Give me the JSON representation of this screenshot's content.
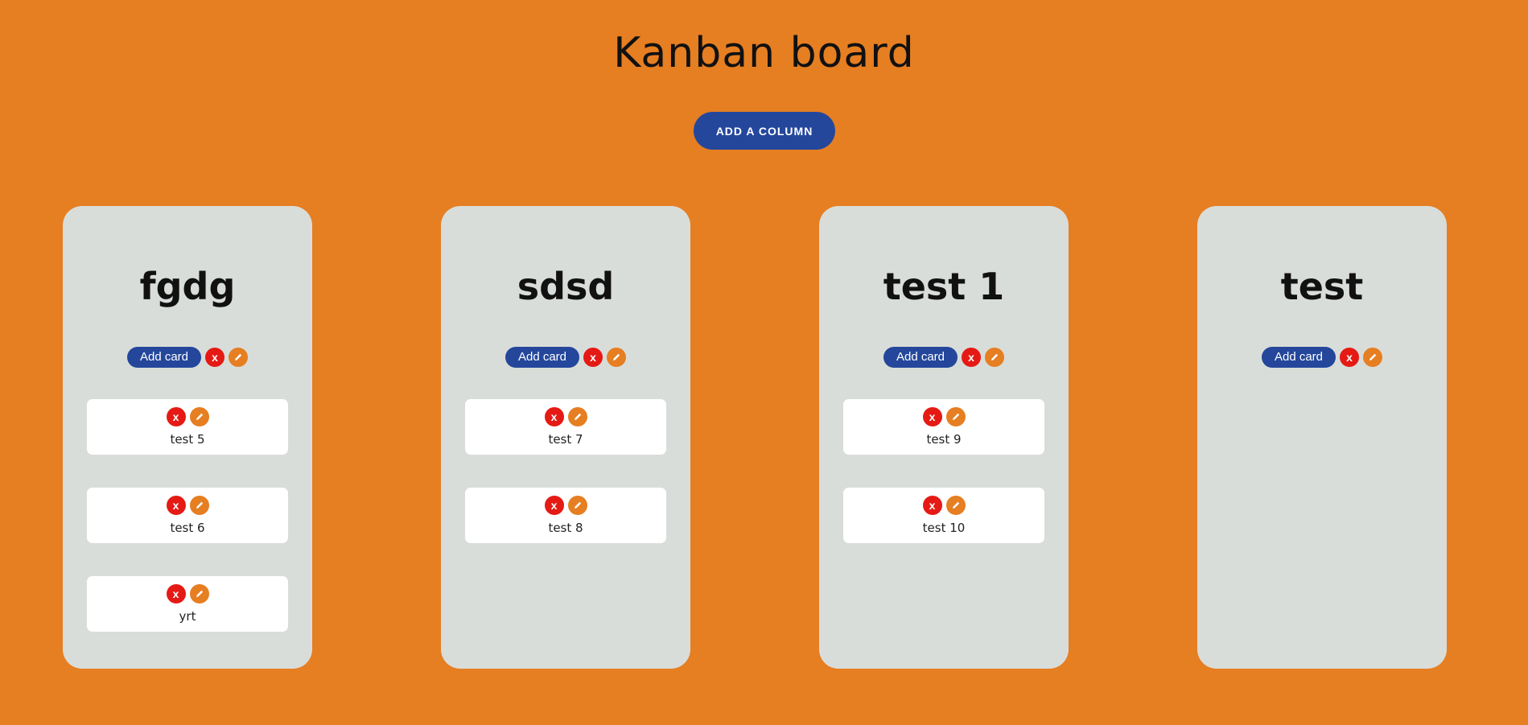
{
  "page": {
    "title": "Kanban board",
    "add_column_label": "ADD A COLUMN"
  },
  "colors": {
    "background": "#e67e22",
    "primary_button": "#24479c",
    "delete": "#e51a14",
    "edit": "#e67e22",
    "column": "#d9ddd9",
    "card": "#ffffff"
  },
  "icons": {
    "delete": "x-icon",
    "edit": "pencil-icon"
  },
  "columns": [
    {
      "title": "fgdg",
      "add_card_label": "Add card",
      "delete_label": "x",
      "cards": [
        {
          "text": "test 5",
          "delete_label": "x"
        },
        {
          "text": "test 6",
          "delete_label": "x"
        },
        {
          "text": "yrt",
          "delete_label": "x"
        }
      ]
    },
    {
      "title": "sdsd",
      "add_card_label": "Add card",
      "delete_label": "x",
      "cards": [
        {
          "text": "test 7",
          "delete_label": "x"
        },
        {
          "text": "test 8",
          "delete_label": "x"
        }
      ]
    },
    {
      "title": "test 1",
      "add_card_label": "Add card",
      "delete_label": "x",
      "cards": [
        {
          "text": "test 9",
          "delete_label": "x"
        },
        {
          "text": "test 10",
          "delete_label": "x"
        }
      ]
    },
    {
      "title": "test",
      "add_card_label": "Add card",
      "delete_label": "x",
      "cards": []
    }
  ]
}
